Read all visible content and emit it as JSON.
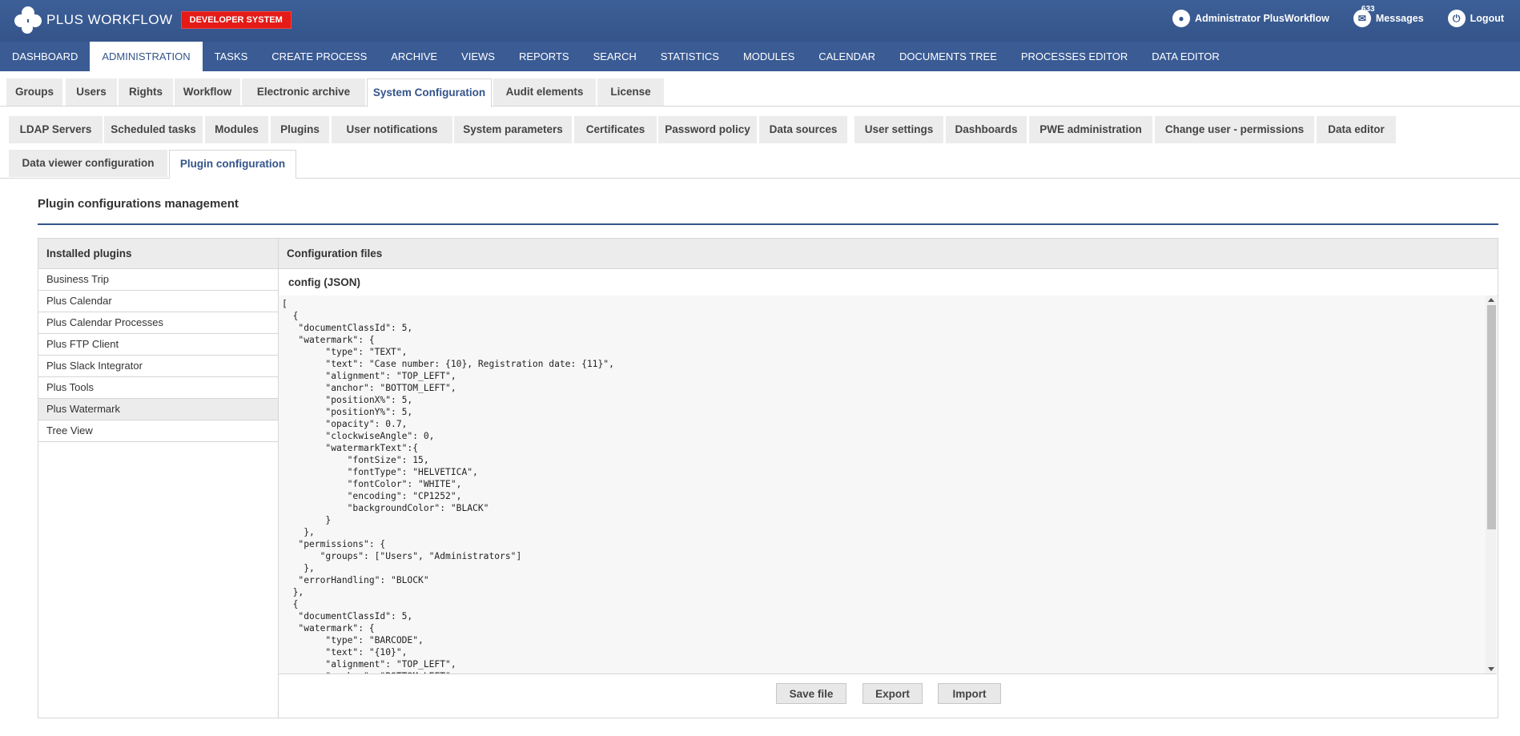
{
  "app": {
    "brand_plus": "PLUS",
    "brand_workflow": "WORKFLOW",
    "badge": "DEVELOPER SYSTEM",
    "user": "Administrator PlusWorkflow",
    "messages_label": "Messages",
    "messages_count": "633",
    "logout_label": "Logout"
  },
  "main_nav": [
    "DASHBOARD",
    "ADMINISTRATION",
    "TASKS",
    "CREATE PROCESS",
    "ARCHIVE",
    "VIEWS",
    "REPORTS",
    "SEARCH",
    "STATISTICS",
    "MODULES",
    "CALENDAR",
    "DOCUMENTS TREE",
    "PROCESSES EDITOR",
    "DATA EDITOR"
  ],
  "main_nav_active": "ADMINISTRATION",
  "admin_tabs": [
    "Groups",
    "Users",
    "Rights",
    "Workflow",
    "Electronic archive",
    "System Configuration",
    "Audit elements",
    "License"
  ],
  "admin_tabs_active": "System Configuration",
  "sysconf_tabs_row1": [
    "LDAP Servers",
    "Scheduled tasks",
    "Modules",
    "Plugins",
    "User notifications",
    "System parameters",
    "Certificates",
    "Password policy",
    "Data sources",
    "User settings",
    "Dashboards",
    "PWE administration",
    "Change user - permissions",
    "Data editor"
  ],
  "sysconf_tabs_row2": [
    "Data viewer configuration",
    "Plugin configuration"
  ],
  "sysconf_tabs_active": "Plugin configuration",
  "page": {
    "title": "Plugin configurations management",
    "installed_header": "Installed plugins",
    "config_header": "Configuration files",
    "config_file_label": "config (JSON)"
  },
  "plugins": [
    "Business Trip",
    "Plus Calendar",
    "Plus Calendar Processes",
    "Plus FTP Client",
    "Plus Slack Integrator",
    "Plus Tools",
    "Plus Watermark",
    "Tree View"
  ],
  "selected_plugin": "Plus Watermark",
  "config_text": "[\n  {\n   \"documentClassId\": 5,\n   \"watermark\": {\n        \"type\": \"TEXT\",\n        \"text\": \"Case number: {10}, Registration date: {11}\",\n        \"alignment\": \"TOP_LEFT\",\n        \"anchor\": \"BOTTOM_LEFT\",\n        \"positionX%\": 5,\n        \"positionY%\": 5,\n        \"opacity\": 0.7,\n        \"clockwiseAngle\": 0,\n        \"watermarkText\":{\n            \"fontSize\": 15,\n            \"fontType\": \"HELVETICA\",\n            \"fontColor\": \"WHITE\",\n            \"encoding\": \"CP1252\",\n            \"backgroundColor\": \"BLACK\"\n        }\n    },\n   \"permissions\": {\n       \"groups\": [\"Users\", \"Administrators\"]\n    },\n   \"errorHandling\": \"BLOCK\"\n  },\n  {\n   \"documentClassId\": 5,\n   \"watermark\": {\n        \"type\": \"BARCODE\",\n        \"text\": \"{10}\",\n        \"alignment\": \"TOP_LEFT\",\n        \"anchor\": \"BOTTOM_LEFT\",",
  "buttons": {
    "save": "Save file",
    "export": "Export",
    "import": "Import"
  },
  "colors": {
    "header_blue": "#34548a",
    "badge_red": "#e41b17",
    "tab_gray": "#ececec"
  }
}
